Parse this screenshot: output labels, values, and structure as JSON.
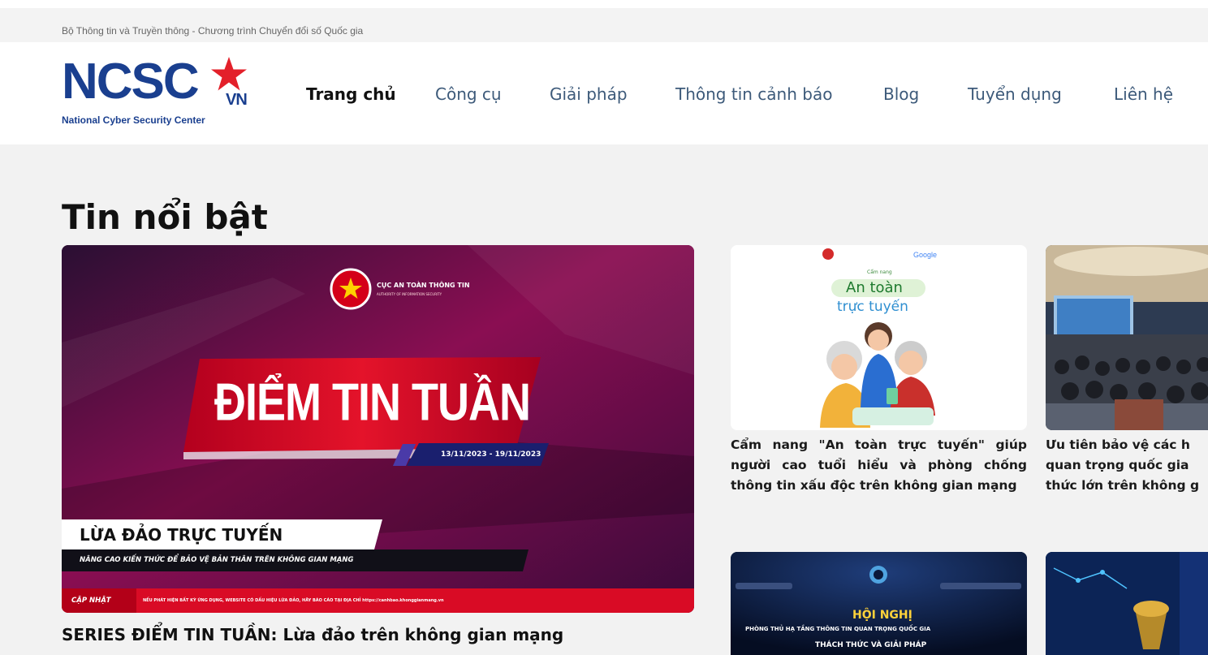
{
  "top_bar": {
    "tagline": "Bộ Thông tin và Truyền thông - Chương trình Chuyển đổi số Quốc gia"
  },
  "logo": {
    "wordmark": "NCSC",
    "suffix": "VN",
    "subtitle": "National Cyber Security Center",
    "brand_color": "#1a3f8f",
    "star_color": "#e3202a"
  },
  "nav": {
    "items": [
      {
        "label": "Trang chủ",
        "active": true
      },
      {
        "label": "Công cụ",
        "active": false
      },
      {
        "label": "Giải pháp",
        "active": false
      },
      {
        "label": "Thông tin cảnh báo",
        "active": false
      },
      {
        "label": "Blog",
        "active": false
      },
      {
        "label": "Tuyển dụng",
        "active": false
      },
      {
        "label": "Liên hệ",
        "active": false
      }
    ]
  },
  "section": {
    "title": "Tin nổi bật"
  },
  "featured": {
    "title": "SERIES ĐIỂM TIN TUẦN: Lừa đảo trên không gian mạng",
    "image": {
      "org_name": "CỤC AN TOÀN THÔNG TIN",
      "org_sub": "AUTHORITY OF INFORMATION SECURITY",
      "headline": "ĐIỂM TIN TUẦN",
      "date_range": "13/11/2023 - 19/11/2023",
      "topic": "LỪA ĐẢO TRỰC TUYẾN",
      "subtopic": "NÂNG CAO KIẾN THỨC ĐỂ BẢO VỆ BẢN THÂN TRÊN KHÔNG GIAN MẠNG",
      "update_label": "CẬP NHẬT",
      "update_text": "NẾU PHÁT HIỆN BẤT KỲ ỨNG DỤNG, WEBSITE CÓ DẤU HIỆU LỪA ĐẢO, HÃY BÁO CÁO TẠI ĐỊA CHỈ https://canhbao.khonggianmang.vn"
    }
  },
  "cards": [
    {
      "title": "Cẩm nang \"An toàn trực tuyến\" giúp người cao tuổi hiểu và phòng chống thông tin xấu độc trên không gian mạng",
      "image": {
        "brand": "Google",
        "small": "Cẩm nang",
        "headline_1": "An toàn",
        "headline_2": "trực tuyến"
      }
    },
    {
      "title": "Ưu tiên bảo vệ các hệ thống thông tin quan trọng quốc gia trước những thách thức lớn trên không gian mạng",
      "title_visible": "Ưu tiên bảo vệ các h quan trọng quốc gia thức lớn trên không g",
      "image": {}
    },
    {
      "title": "",
      "image": {
        "headline": "HỘI NGHỊ",
        "line_2": "PHÒNG THỦ HẠ TẦNG THÔNG TIN QUAN TRỌNG QUỐC GIA",
        "line_3": "THÁCH THỨC VÀ GIẢI PHÁP"
      }
    },
    {
      "title": "",
      "image": {}
    }
  ]
}
